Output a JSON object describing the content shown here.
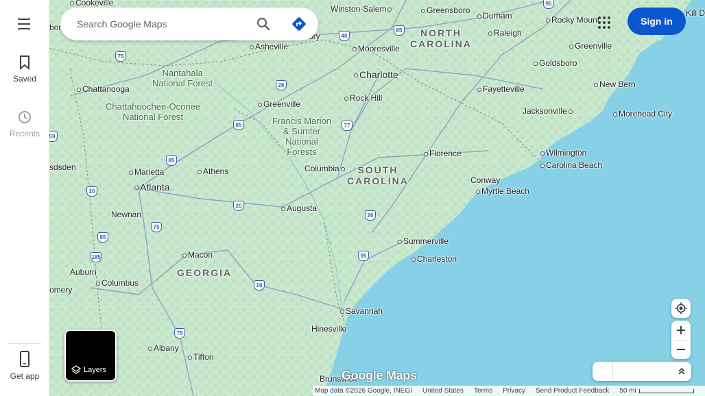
{
  "rail": {
    "saved_label": "Saved",
    "recents_label": "Recents",
    "get_app_label": "Get app"
  },
  "search": {
    "placeholder": "Search Google Maps"
  },
  "header": {
    "sign_in_label": "Sign in"
  },
  "map": {
    "states": [
      {
        "id": "nc",
        "line1": "NORTH",
        "line2": "CAROLINA"
      },
      {
        "id": "sc",
        "line1": "SOUTH",
        "line2": "CAROLINA"
      },
      {
        "id": "ga",
        "line1": "GEORGIA",
        "line2": ""
      }
    ],
    "parks": [
      {
        "id": "nantahala",
        "line1": "Nantahala",
        "line2": "National Forest"
      },
      {
        "id": "chattahoochee",
        "line1": "Chattahoochee-Oconee",
        "line2": "National Forest"
      },
      {
        "id": "francis",
        "line1": "Francis Marion",
        "line2": "& Sumter",
        "line3": "National",
        "line4": "Forests"
      }
    ],
    "places": {
      "cookeville": "Cookeville",
      "winston_salem": "Winston-Salem",
      "greensboro": "Greensboro",
      "durham": "Durham",
      "rocky_mount": "Rocky Mount",
      "kill_de": "Kill De",
      "asheville": "Asheville",
      "ory": "ory",
      "boro": "boro",
      "mooresville": "Mooresville",
      "raleigh": "Raleigh",
      "greenville_nc": "Greenville",
      "charlotte": "Charlotte",
      "goldsboro": "Goldsboro",
      "chattanooga": "Chattanooga",
      "fayetteville": "Fayetteville",
      "new_bern": "New Bern",
      "rock_hill": "Rock Hill",
      "greenville_sc": "Greenville",
      "jacksonville": "Jacksonville",
      "morehead": "Morehead City",
      "florence": "Florence",
      "wilmington": "Wilmington",
      "sdsden": "sdsden",
      "columbia": "Columbia",
      "carolina_beach": "Carolina Beach",
      "marietta": "Marietta",
      "athens": "Athens",
      "atlanta": "Atlanta",
      "conway": "Conway",
      "myrtle_beach": "Myrtle Beach",
      "augusta": "Augusta",
      "newnan": "Newnan",
      "summerville": "Summerville",
      "macon": "Macon",
      "charleston": "Charleston",
      "auburn": "Auburn",
      "columbus": "Columbus",
      "omery": "omery",
      "savannah": "Savannah",
      "hinesville": "Hinesville",
      "albany": "Albany",
      "tifton": "Tifton",
      "brunswick": "Brunswick"
    },
    "shields": [
      "95",
      "40",
      "85",
      "75",
      "26",
      "77",
      "85",
      "59",
      "85",
      "20",
      "20",
      "75",
      "26",
      "85",
      "95",
      "185",
      "16",
      "75"
    ]
  },
  "layers": {
    "label": "Layers"
  },
  "watermark": "Google Maps",
  "footer": {
    "map_data": "Map data ©2026 Google, INEGI",
    "region": "United States",
    "terms": "Terms",
    "privacy": "Privacy",
    "feedback": "Send Product Feedback",
    "scale": "50 mi"
  },
  "colors": {
    "land": "#c8e6cf",
    "water": "#7fd0e8",
    "accent": "#0b57d0"
  }
}
